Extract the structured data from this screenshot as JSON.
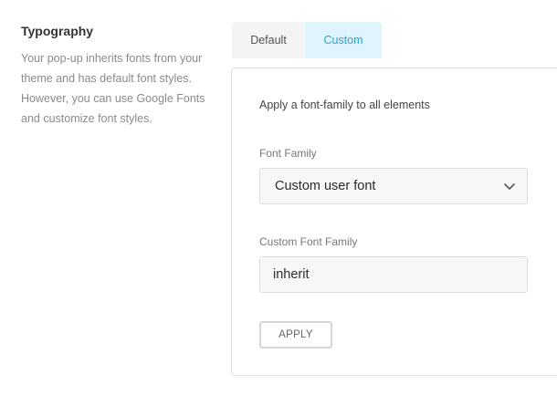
{
  "sidebar": {
    "title": "Typography",
    "description": "Your pop-up inherits fonts from your theme and has default font styles. However, you can use Google Fonts and customize font styles."
  },
  "tabs": [
    {
      "label": "Default",
      "active": false
    },
    {
      "label": "Custom",
      "active": true
    }
  ],
  "panel": {
    "heading": "Apply a font-family to all elements",
    "font_family": {
      "label": "Font Family",
      "selected": "Custom user font",
      "icon": "chevron-down-icon"
    },
    "custom_font_family": {
      "label": "Custom Font Family",
      "value": "inherit"
    },
    "apply_label": "APPLY"
  },
  "colors": {
    "accent": "#2aa4d6",
    "active_tab_bg": "#dff4fc",
    "inactive_tab_bg": "#f4f4f4",
    "border": "#e2e2e2"
  }
}
